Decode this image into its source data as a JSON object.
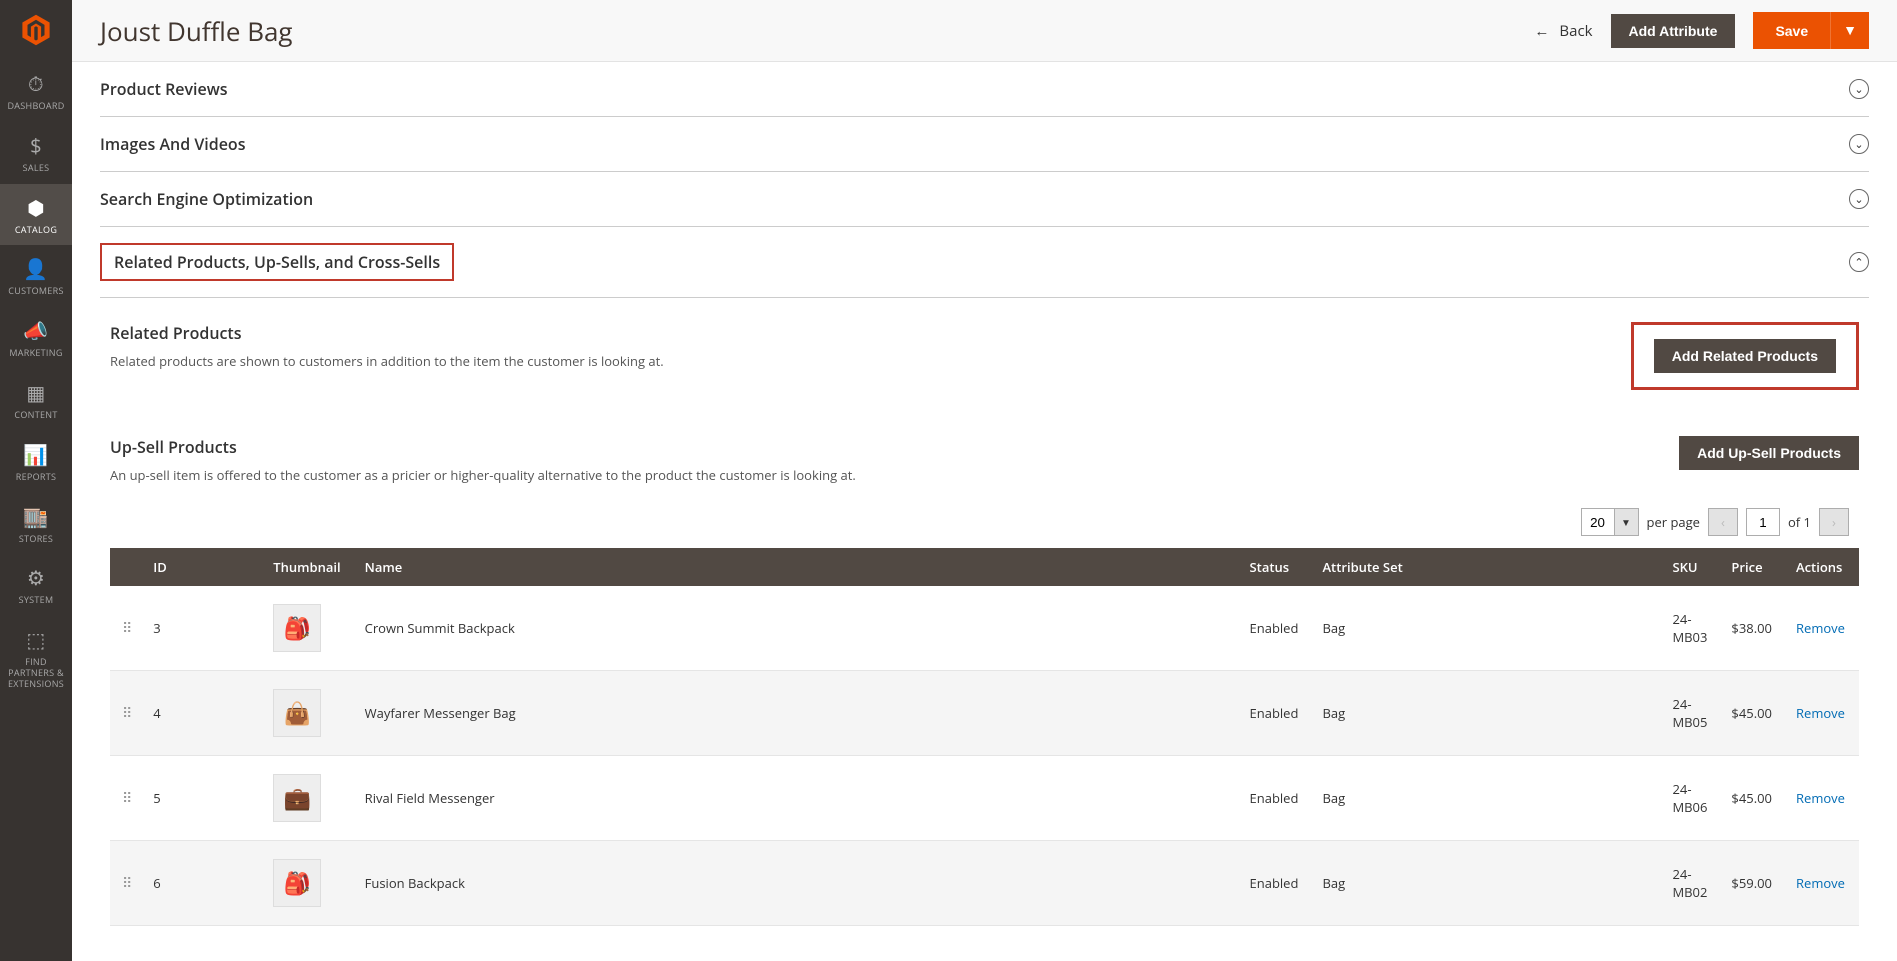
{
  "sidebar": {
    "items": [
      {
        "label": "DASHBOARD"
      },
      {
        "label": "SALES"
      },
      {
        "label": "CATALOG"
      },
      {
        "label": "CUSTOMERS"
      },
      {
        "label": "MARKETING"
      },
      {
        "label": "CONTENT"
      },
      {
        "label": "REPORTS"
      },
      {
        "label": "STORES"
      },
      {
        "label": "SYSTEM"
      },
      {
        "label": "FIND PARTNERS & EXTENSIONS"
      }
    ]
  },
  "header": {
    "title": "Joust Duffle Bag",
    "back": "Back",
    "add_attribute": "Add Attribute",
    "save": "Save"
  },
  "sections": {
    "reviews": "Product Reviews",
    "images": "Images And Videos",
    "seo": "Search Engine Optimization",
    "related": "Related Products, Up-Sells, and Cross-Sells"
  },
  "related_products": {
    "title": "Related Products",
    "desc": "Related products are shown to customers in addition to the item the customer is looking at.",
    "button": "Add Related Products"
  },
  "upsell": {
    "title": "Up-Sell Products",
    "desc": "An up-sell item is offered to the customer as a pricier or higher-quality alternative to the product the customer is looking at.",
    "button": "Add Up-Sell Products"
  },
  "pagination": {
    "per_page_value": "20",
    "per_page_label": "per page",
    "current": "1",
    "of_label": "of 1"
  },
  "grid": {
    "headers": {
      "id": "ID",
      "thumbnail": "Thumbnail",
      "name": "Name",
      "status": "Status",
      "attribute_set": "Attribute Set",
      "sku": "SKU",
      "price": "Price",
      "actions": "Actions"
    },
    "rows": [
      {
        "id": "3",
        "name": "Crown Summit Backpack",
        "status": "Enabled",
        "attr": "Bag",
        "sku": "24-MB03",
        "price": "$38.00",
        "action": "Remove",
        "thumb": "🎒"
      },
      {
        "id": "4",
        "name": "Wayfarer Messenger Bag",
        "status": "Enabled",
        "attr": "Bag",
        "sku": "24-MB05",
        "price": "$45.00",
        "action": "Remove",
        "thumb": "👜"
      },
      {
        "id": "5",
        "name": "Rival Field Messenger",
        "status": "Enabled",
        "attr": "Bag",
        "sku": "24-MB06",
        "price": "$45.00",
        "action": "Remove",
        "thumb": "💼"
      },
      {
        "id": "6",
        "name": "Fusion Backpack",
        "status": "Enabled",
        "attr": "Bag",
        "sku": "24-MB02",
        "price": "$59.00",
        "action": "Remove",
        "thumb": "🎒"
      }
    ]
  }
}
